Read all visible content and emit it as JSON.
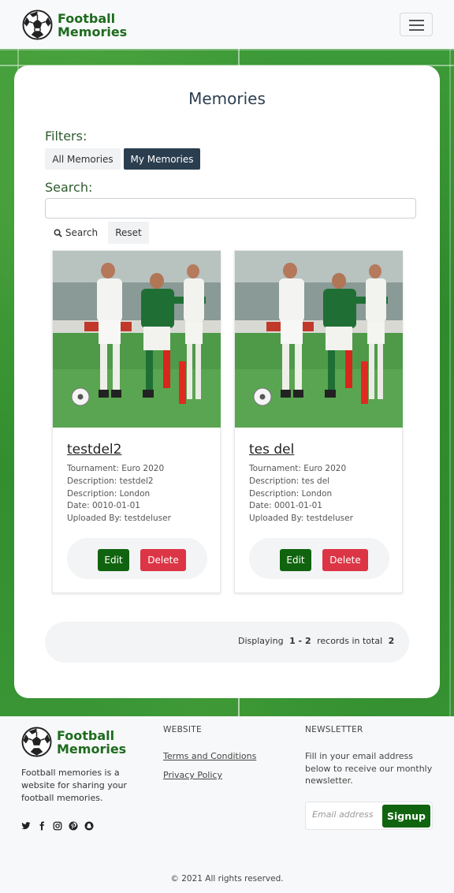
{
  "brand": {
    "line1": "Football",
    "line2": "Memories"
  },
  "main": {
    "title": "Memories",
    "filters_label": "Filters:",
    "filter_all": "All Memories",
    "filter_mine": "My Memories",
    "search_label": "Search:",
    "search_value": "",
    "search_button": "Search",
    "reset_button": "Reset"
  },
  "memories": [
    {
      "title": "testdel2",
      "tournament": "Tournament: Euro 2020",
      "description": "Description: testdel2",
      "location": "Description: London",
      "date": "Date: 0010-01-01",
      "uploaded_by": "Uploaded By: testdeluser",
      "edit_label": "Edit",
      "delete_label": "Delete"
    },
    {
      "title": "tes del",
      "tournament": "Tournament: Euro 2020",
      "description": "Description: tes del",
      "location": "Description: London",
      "date": "Date: 0001-01-01",
      "uploaded_by": "Uploaded By: testdeluser",
      "edit_label": "Edit",
      "delete_label": "Delete"
    }
  ],
  "pager": {
    "prefix": "Displaying",
    "range": "1 - 2",
    "middle": "records in total",
    "total": "2"
  },
  "footer": {
    "description": "Football memories is a website for sharing your football memories.",
    "website_heading": "WEBSITE",
    "terms": "Terms and Conditions",
    "privacy": "Privacy Policy",
    "newsletter_heading": "NEWSLETTER",
    "newsletter_text": "Fill in your email address below to receive our monthly newsletter.",
    "email_placeholder": "Email address",
    "signup": "Signup",
    "copyright": "© 2021 All rights reserved.",
    "social_icons": [
      "twitter-icon",
      "facebook-icon",
      "instagram-icon",
      "pinterest-icon",
      "snapchat-icon"
    ]
  },
  "colors": {
    "brand_green": "#1e6b1e",
    "button_green": "#11640f",
    "delete_red": "#dc3545",
    "active_filter": "#2b3e4f"
  }
}
